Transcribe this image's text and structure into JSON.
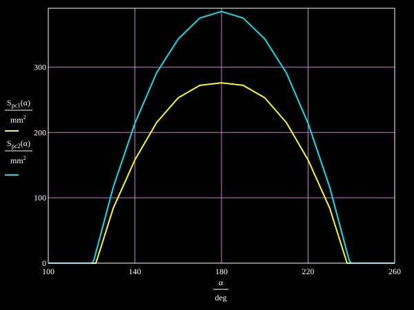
{
  "chart_data": {
    "type": "line",
    "xlim": [
      100,
      260
    ],
    "ylim": [
      0,
      390
    ],
    "xticks": [
      "100",
      "140",
      "180",
      "220",
      "260"
    ],
    "yticks": [
      "0",
      "100",
      "200",
      "300"
    ],
    "grid": true,
    "colors": {
      "background": "#000000",
      "axes": "#ffffff",
      "grid": "#c880c8"
    },
    "xlabel": {
      "numerator": "α",
      "denominator": "deg"
    },
    "ylabel": [
      {
        "name_main": "S",
        "name_sub": "pc1",
        "arg": "(α)",
        "denominator_main": "mm",
        "denominator_sup": "2",
        "color": "#ffff00"
      },
      {
        "name_main": "S",
        "name_sub": "pc2",
        "arg": "(α)",
        "denominator_main": "mm",
        "denominator_sup": "2",
        "color": "#00e5ee"
      }
    ],
    "series": [
      {
        "color": "#ffff00",
        "x": [
          100,
          110,
          121,
          122,
          130,
          140,
          150,
          160,
          170,
          180,
          190,
          200,
          210,
          220,
          230,
          238,
          239,
          250,
          260
        ],
        "y": [
          0,
          0,
          0,
          0,
          84,
          158,
          215,
          253,
          272,
          276,
          272,
          253,
          215,
          158,
          84,
          0,
          0,
          0,
          0
        ]
      },
      {
        "color": "#00e5ee",
        "x": [
          100,
          110,
          120,
          121,
          130,
          140,
          150,
          160,
          170,
          180,
          190,
          200,
          210,
          220,
          230,
          239,
          240,
          250,
          260
        ],
        "y": [
          0,
          0,
          0,
          4,
          116,
          214,
          291,
          343,
          375,
          385,
          375,
          343,
          291,
          214,
          116,
          4,
          0,
          0,
          0
        ]
      }
    ]
  }
}
